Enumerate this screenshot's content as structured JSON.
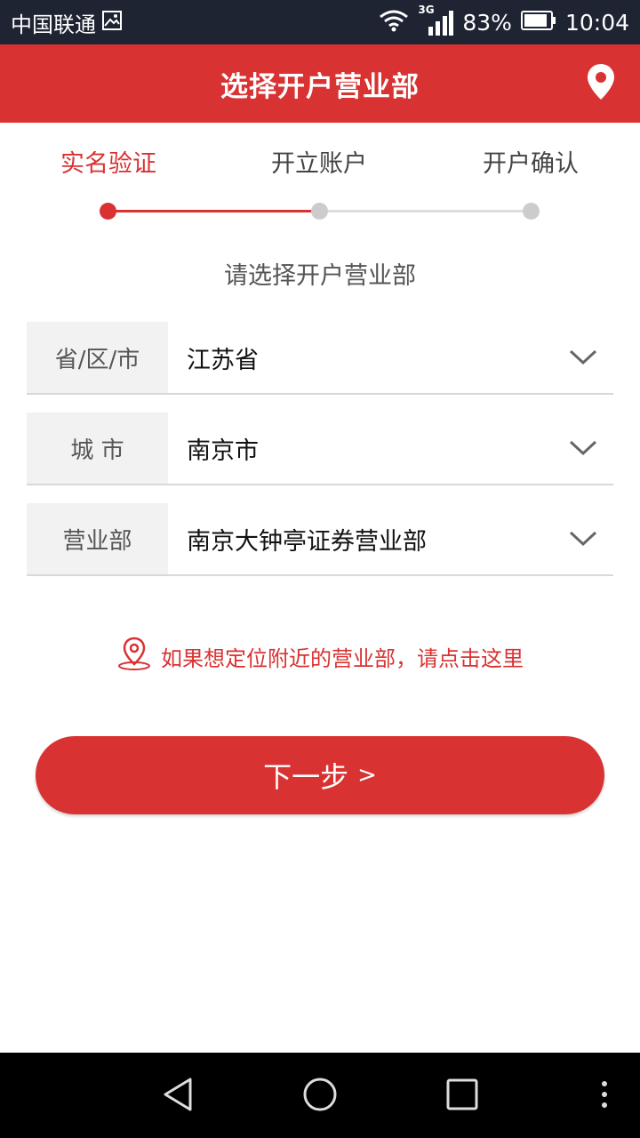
{
  "status_bar": {
    "carrier": "中国联通",
    "network": "3G",
    "battery": "83%",
    "time": "10:04"
  },
  "header": {
    "title": "选择开户营业部",
    "location_icon": "location-pin-icon"
  },
  "steps": [
    {
      "label": "实名验证",
      "active": true
    },
    {
      "label": "开立账户",
      "active": false
    },
    {
      "label": "开户确认",
      "active": false
    }
  ],
  "prompt": "请选择开户营业部",
  "form": {
    "province": {
      "label": "省/区/市",
      "value": "江苏省"
    },
    "city": {
      "label": "城 市",
      "value": "南京市"
    },
    "branch": {
      "label": "营业部",
      "value": "南京大钟亭证券营业部"
    }
  },
  "locate_link": "如果想定位附近的营业部，请点击这里",
  "next_button": {
    "label": "下一步",
    "arrow": ">"
  },
  "colors": {
    "accent": "#d93232",
    "status_bar": "#1f2433",
    "nav_bar": "#000000"
  }
}
